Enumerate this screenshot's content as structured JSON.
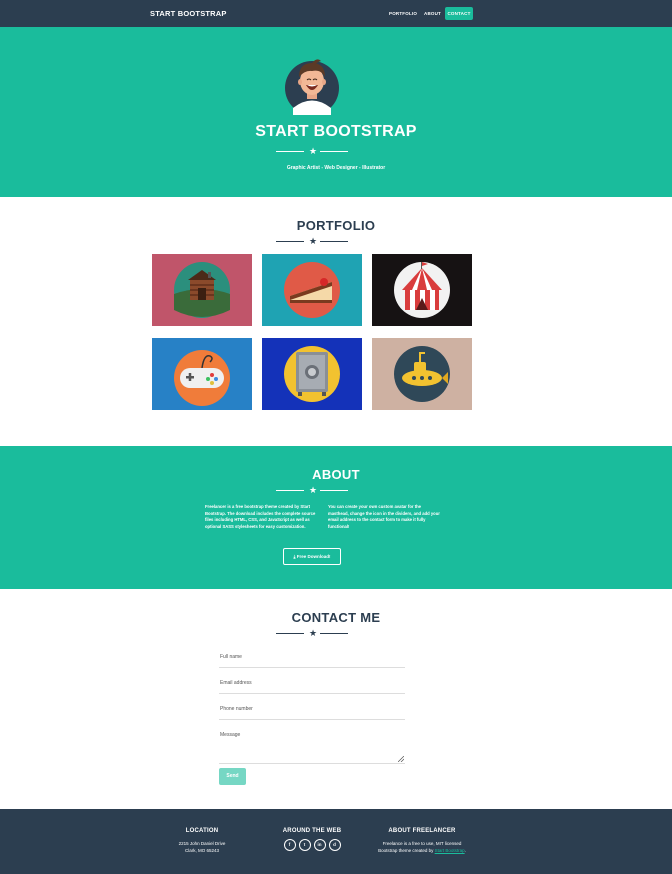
{
  "navbar": {
    "brand": "START BOOTSTRAP",
    "links": [
      "PORTFOLIO",
      "ABOUT",
      "CONTACT"
    ]
  },
  "header": {
    "title": "START BOOTSTRAP",
    "subtitle": "Graphic Artist - Web Designer - Illustrator"
  },
  "portfolio": {
    "title": "PORTFOLIO",
    "items": [
      {
        "name": "cabin",
        "bg": "#c0556a"
      },
      {
        "name": "cake",
        "bg": "#1fa3b3"
      },
      {
        "name": "circus",
        "bg": "#161213"
      },
      {
        "name": "game-controller",
        "bg": "#2781c6"
      },
      {
        "name": "safe",
        "bg": "#1432b9"
      },
      {
        "name": "submarine",
        "bg": "#ceb1a2"
      }
    ]
  },
  "about": {
    "title": "ABOUT",
    "left_text": "Freelancer is a free bootstrap theme created by Start Bootstrap. The download includes the complete source files including HTML, CSS, and JavaScript as well as optional SASS stylesheets for easy customization.",
    "right_text": "You can create your own custom avatar for the masthead, change the icon in the dividers, and add your email address to the contact form to make it fully functional!",
    "download_label": "Free Download!"
  },
  "contact": {
    "title": "CONTACT ME",
    "fields": {
      "name": "Full name",
      "email": "Email address",
      "phone": "Phone number",
      "message": "Message"
    },
    "send_label": "Send"
  },
  "footer": {
    "location_title": "LOCATION",
    "address_line1": "2215 John Daniel Drive",
    "address_line2": "Clark, MO 65243",
    "web_title": "AROUND THE WEB",
    "social": [
      "f",
      "t",
      "in",
      "d"
    ],
    "about_title": "ABOUT FREELANCER",
    "about_text_line1": "Freelance is a free to use, MIT licensed",
    "about_text_line2": "Bootstrap theme created by ",
    "about_link": "Start Bootstrap",
    "about_text_end": "."
  },
  "colors": {
    "primary": "#1abc9c",
    "secondary": "#2c3e50"
  }
}
